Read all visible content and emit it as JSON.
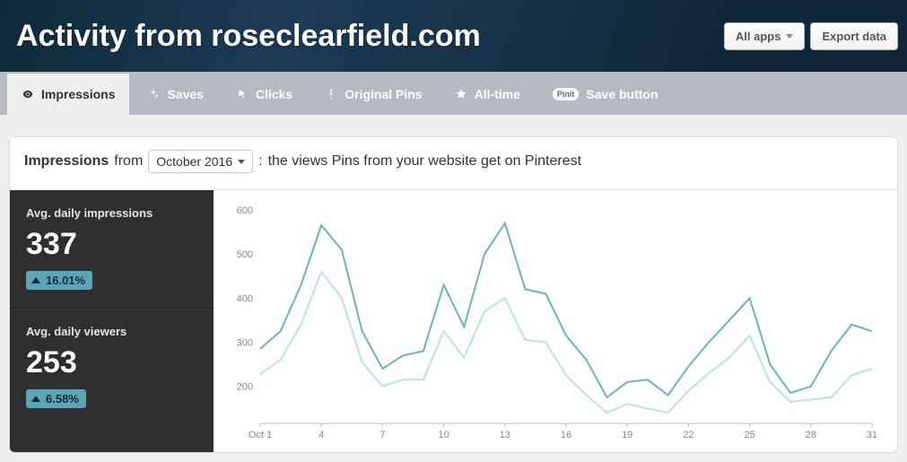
{
  "header": {
    "title": "Activity from roseclearfield.com",
    "all_apps_label": "All apps",
    "export_label": "Export data"
  },
  "tabs": {
    "impressions": "Impressions",
    "saves": "Saves",
    "clicks": "Clicks",
    "original_pins": "Original Pins",
    "all_time": "All-time",
    "save_button": "Save button",
    "pinit_badge": "Pinit"
  },
  "summary": {
    "metric_bold": "Impressions",
    "from_word": "from",
    "date_label": "October 2016",
    "colon": ":",
    "description": "the views Pins from your website get on Pinterest"
  },
  "stats": {
    "impressions_label": "Avg. daily impressions",
    "impressions_value": "337",
    "impressions_change": "16.01%",
    "viewers_label": "Avg. daily viewers",
    "viewers_value": "253",
    "viewers_change": "6.58%"
  },
  "chart_axis": {
    "y_ticks": [
      "200",
      "300",
      "400",
      "500",
      "600"
    ],
    "x_ticks": [
      "Oct 1",
      "4",
      "7",
      "10",
      "13",
      "16",
      "19",
      "22",
      "25",
      "28",
      "31"
    ]
  },
  "chart_data": {
    "type": "line",
    "title": "Impressions — October 2016",
    "xlabel": "",
    "ylabel": "",
    "ylim": [
      120,
      600
    ],
    "x": [
      1,
      2,
      3,
      4,
      5,
      6,
      7,
      8,
      9,
      10,
      11,
      12,
      13,
      14,
      15,
      16,
      17,
      18,
      19,
      20,
      21,
      22,
      23,
      24,
      25,
      26,
      27,
      28,
      29,
      30,
      31
    ],
    "x_tick_labels": [
      "Oct 1",
      "4",
      "7",
      "10",
      "13",
      "16",
      "19",
      "22",
      "25",
      "28",
      "31"
    ],
    "series": [
      {
        "name": "Avg. daily impressions",
        "values": [
          285,
          325,
          430,
          565,
          510,
          325,
          240,
          270,
          280,
          430,
          335,
          500,
          570,
          420,
          410,
          315,
          260,
          175,
          210,
          215,
          180,
          245,
          300,
          350,
          400,
          250,
          185,
          200,
          280,
          340,
          325
        ]
      },
      {
        "name": "Avg. daily viewers",
        "values": [
          228,
          260,
          340,
          460,
          400,
          255,
          200,
          215,
          215,
          325,
          265,
          370,
          400,
          305,
          300,
          225,
          180,
          140,
          160,
          150,
          140,
          190,
          230,
          265,
          315,
          210,
          165,
          170,
          175,
          225,
          240
        ]
      }
    ]
  }
}
